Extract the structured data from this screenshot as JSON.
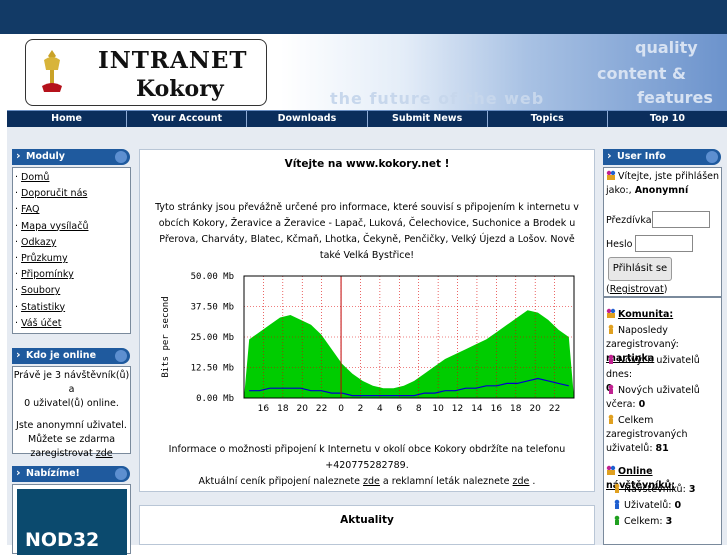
{
  "banner": {
    "logo_title": "INTRANET",
    "logo_subtitle": "Kokory",
    "slogan": "the future of the web",
    "tagline_1": "quality",
    "tagline_2": "content &",
    "tagline_3": "features"
  },
  "nav": [
    "Home",
    "Your Account",
    "Downloads",
    "Submit News",
    "Topics",
    "Top 10"
  ],
  "modules": {
    "title": "Moduly",
    "items": [
      "Domů",
      "Doporučit nás",
      "FAQ",
      "Mapa vysílačů",
      "Odkazy",
      "Průzkumy",
      "Připomínky",
      "Soubory",
      "Statistiky",
      "Váš účet"
    ]
  },
  "who_online": {
    "title": "Kdo je online",
    "line1": "Právě je 3 návštěvník(ů) a",
    "line2": "0 uživatel(ů) online.",
    "line3": "Jste anonymní uživatel.",
    "line4": "Můžete se zdarma",
    "line5_text": "zaregistrovat ",
    "line5_link": "zde"
  },
  "offer": {
    "title": "Nabízíme!",
    "product": "NOD32"
  },
  "welcome": {
    "title": "Vítejte na www.kokory.net !",
    "description": "Tyto stránky jsou převážně určené pro informace, které souvisí s připojením k internetu v obcích Kokory, Žeravice a Žeravice - Lapač, Luková, Čelechovice, Suchonice a Brodek u Přerova, Charváty, Blatec, Kčmaň, Lhotka, Čekyně, Penčičky, Velký Újezd a Lošov. Nově také Velká Bystřice!",
    "info_line1": "Informace o možnosti připojení k Internetu v okolí obce Kokory obdržíte na telefonu +420775282789.",
    "info_line2_a": "Aktuální ceník připojení naleznete ",
    "info_link1": "zde",
    "info_line2_b": " a reklamní leták naleznete ",
    "info_link2": "zde",
    "info_line2_c": " ."
  },
  "chart_data": {
    "type": "area",
    "ylabel": "Bits per second",
    "ylim": [
      0,
      50
    ],
    "y_ticks": [
      "50.00 Mb",
      "37.50 Mb",
      "25.00 Mb",
      "12.50 Mb",
      "0.00 Mb"
    ],
    "x_ticks": [
      "16",
      "18",
      "20",
      "22",
      "0",
      "2",
      "4",
      "6",
      "8",
      "10",
      "12",
      "14",
      "16",
      "18",
      "20",
      "22"
    ],
    "grid": true,
    "series": [
      {
        "color": "#00cc00",
        "x": [
          16,
          17,
          18,
          19,
          20,
          21,
          22,
          23,
          0,
          1,
          2,
          3,
          4,
          5,
          6,
          7,
          8,
          9,
          10,
          11,
          12,
          13,
          14,
          15,
          16,
          17,
          18,
          19,
          20,
          21,
          22,
          23
        ],
        "values": [
          24,
          27,
          30,
          33,
          34,
          32,
          30,
          26,
          20,
          14,
          10,
          7,
          5,
          4,
          4,
          5,
          7,
          10,
          13,
          16,
          18,
          20,
          22,
          24,
          27,
          30,
          33,
          36,
          35,
          32,
          28,
          25
        ]
      },
      {
        "color": "#0000cc",
        "x": [
          16,
          17,
          18,
          19,
          20,
          21,
          22,
          23,
          0,
          1,
          2,
          3,
          4,
          5,
          6,
          7,
          8,
          9,
          10,
          11,
          12,
          13,
          14,
          15,
          16,
          17,
          18,
          19,
          20,
          21,
          22,
          23
        ],
        "values": [
          3,
          3,
          4,
          4,
          4,
          4,
          3,
          3,
          2,
          2,
          1,
          1,
          1,
          1,
          1,
          1,
          1,
          2,
          2,
          3,
          3,
          4,
          4,
          5,
          5,
          6,
          6,
          7,
          8,
          7,
          6,
          5
        ]
      }
    ]
  },
  "news": {
    "title": "Aktuality"
  },
  "user_info": {
    "title": "User Info",
    "greeting": "Vítejte, jste přihlášen jako:, ",
    "greeting_name": "Anonymní",
    "nickname_label": "Přezdívka",
    "password_label": "Heslo",
    "login_button": "Přihlásit se",
    "register_prefix": "(",
    "register_link": "Registrovat",
    "register_suffix": ")",
    "community_title": "Komunita:",
    "last_registered_label": "Naposledy zaregistrovaný: ",
    "last_registered_name": "martinka",
    "new_today_label": "Nových uživatelů dnes:",
    "new_today_value": "0",
    "new_yesterday_label": "Nových uživatelů včera: ",
    "new_yesterday_value": "0",
    "total_label": "Celkem zaregistrovaných uživatelů: ",
    "total_value": "81",
    "online_title": "Online návštěvníků:",
    "visitors_label": "Návštěvníků: ",
    "visitors_value": "3",
    "users_label": "Uživatelů: ",
    "users_value": "0",
    "total_online_label": "Celkem: ",
    "total_online_value": "3"
  }
}
